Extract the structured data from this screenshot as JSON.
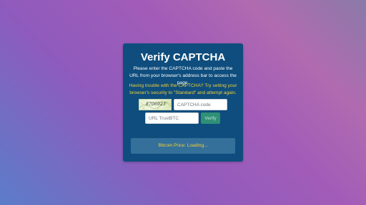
{
  "card": {
    "title": "Verify CAPTCHA",
    "instructions": "Please enter the CAPTCHA code and paste the URL from your browser's address bar to access the page.",
    "trouble": "Having trouble with the CAPTCHA? Try setting your browser's security to \"Standard\" and attempt again."
  },
  "captcha": {
    "image_text": "8706923",
    "code_placeholder": "CAPTCHA code"
  },
  "url": {
    "placeholder": "URL TrustBTC"
  },
  "verify_button": {
    "label": "Verify"
  },
  "price": {
    "text": "Bitcoin Price: Loading..."
  },
  "colors": {
    "card_bg": "#0e4d7d",
    "accent_yellow": "#f2cf3a",
    "verify_green": "#2f8f77",
    "price_box_bg": "#34709a"
  }
}
